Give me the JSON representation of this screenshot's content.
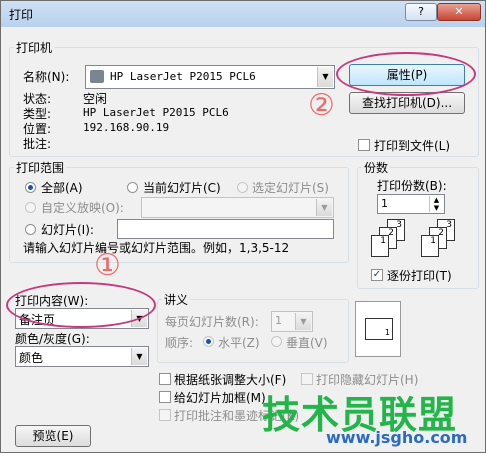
{
  "window": {
    "title": "打印",
    "help": "?",
    "close": "✕"
  },
  "printer": {
    "group": "打印机",
    "name_label": "名称(N):",
    "name_value": "HP LaserJet P2015 PCL6",
    "status_label": "状态:",
    "status_value": "空闲",
    "type_label": "类型:",
    "type_value": "HP LaserJet P2015 PCL6",
    "location_label": "位置:",
    "location_value": "192.168.90.19",
    "comment_label": "批注:",
    "properties_btn": "属性(P)",
    "find_btn": "查找打印机(D)...",
    "print_to_file": "打印到文件(L)"
  },
  "range": {
    "group": "打印范围",
    "all": "全部(A)",
    "current": "当前幻灯片(C)",
    "selection": "选定幻灯片(S)",
    "custom": "自定义放映(O):",
    "slides": "幻灯片(I):",
    "hint": "请输入幻灯片编号或幻灯片范围。例如，1,3,5-12"
  },
  "copies": {
    "group": "份数",
    "count_label": "打印份数(B):",
    "count_value": "1",
    "collate": "逐份打印(T)",
    "page_nums": [
      "1",
      "2",
      "3"
    ]
  },
  "content": {
    "print_what_label": "打印内容(W):",
    "print_what_value": "备注页",
    "color_label": "颜色/灰度(G):",
    "color_value": "颜色"
  },
  "handouts": {
    "group": "讲义",
    "per_page_label": "每页幻灯片数(R):",
    "per_page_value": "1",
    "order_label": "顺序:",
    "horizontal": "水平(Z)",
    "vertical": "垂直(V)",
    "preview_num": "1"
  },
  "options": {
    "fit_paper": "根据纸张调整大小(F)",
    "frame_slides": "给幻灯片加框(M)",
    "comments": "打印批注和墨迹标记(K)",
    "hidden_slides": "打印隐藏幻灯片(H)"
  },
  "footer": {
    "preview_btn": "预览(E)"
  },
  "annotations": {
    "marker1": "①",
    "marker2": "②"
  },
  "watermark": {
    "text": "技术员联盟",
    "url": "www.jsgho.com"
  },
  "colors": {
    "annotation_ellipse": "#c43a7c",
    "annotation_number": "#ee6a6a",
    "watermark": "#23b54a"
  }
}
